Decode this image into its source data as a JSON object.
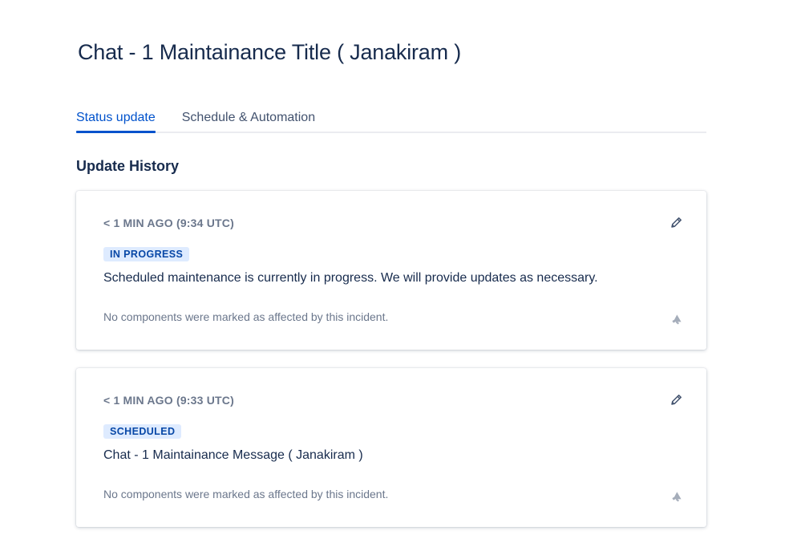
{
  "page": {
    "title": "Chat - 1 Maintainance Title ( Janakiram )"
  },
  "tabs": [
    {
      "label": "Status update",
      "active": true
    },
    {
      "label": "Schedule & Automation",
      "active": false
    }
  ],
  "section": {
    "heading": "Update History"
  },
  "updates": [
    {
      "timestamp": "< 1 MIN AGO (9:34 UTC)",
      "status": "IN PROGRESS",
      "message": "Scheduled maintenance is currently in progress. We will provide updates as necessary.",
      "components_note": "No components were marked as affected by this incident."
    },
    {
      "timestamp": "< 1 MIN AGO (9:33 UTC)",
      "status": "SCHEDULED",
      "message": "Chat - 1 Maintainance Message ( Janakiram )",
      "components_note": "No components were marked as affected by this incident."
    }
  ],
  "icons": {
    "edit": "pencil-icon",
    "notify": "megaphone-icon"
  },
  "colors": {
    "accent": "#0052cc",
    "badge_bg": "#deebff",
    "badge_text": "#0747a6",
    "muted_text": "#6b778c",
    "icon_grey": "#a5adba"
  }
}
